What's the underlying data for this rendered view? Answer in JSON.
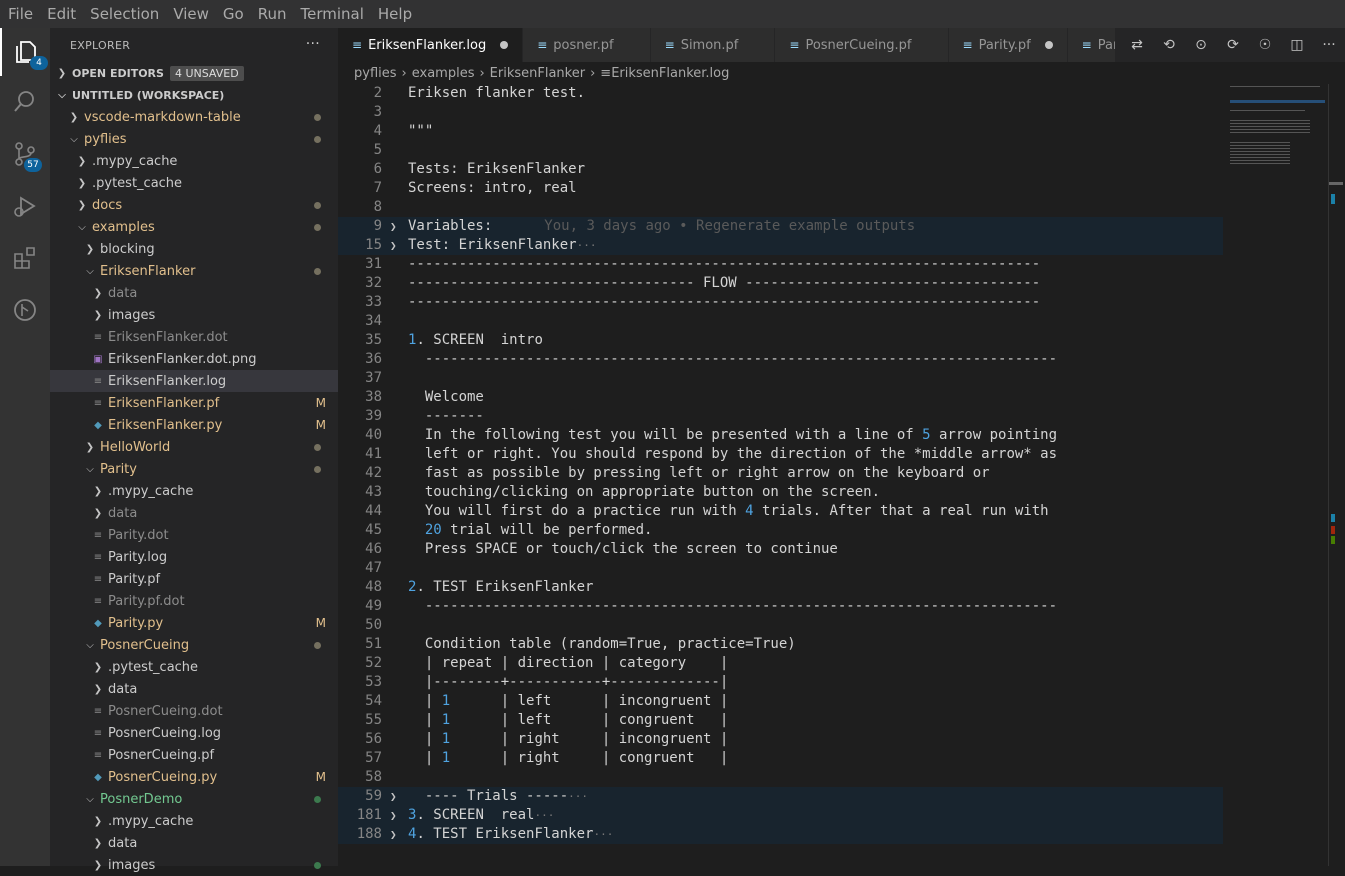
{
  "menu": [
    "File",
    "Edit",
    "Selection",
    "View",
    "Go",
    "Run",
    "Terminal",
    "Help"
  ],
  "activity": {
    "explorer_badge": "4",
    "scm_badge": "57"
  },
  "sidebar": {
    "title": "EXPLORER",
    "open_editors": "OPEN EDITORS",
    "unsaved": "4 UNSAVED",
    "workspace": "UNTITLED (WORKSPACE)",
    "tree": [
      {
        "label": "vscode-markdown-table",
        "indent": 0,
        "type": "folder",
        "open": false,
        "color": "#e2c08d",
        "deco": "dot"
      },
      {
        "label": "pyflies",
        "indent": 0,
        "type": "folder",
        "open": true,
        "color": "#e2c08d",
        "deco": "dot"
      },
      {
        "label": ".mypy_cache",
        "indent": 1,
        "type": "folder",
        "open": false,
        "color": "#cccccc",
        "deco": ""
      },
      {
        "label": ".pytest_cache",
        "indent": 1,
        "type": "folder",
        "open": false,
        "color": "#cccccc",
        "deco": ""
      },
      {
        "label": "docs",
        "indent": 1,
        "type": "folder",
        "open": false,
        "color": "#e2c08d",
        "deco": "dot"
      },
      {
        "label": "examples",
        "indent": 1,
        "type": "folder",
        "open": true,
        "color": "#e2c08d",
        "deco": "dot"
      },
      {
        "label": "blocking",
        "indent": 2,
        "type": "folder",
        "open": false,
        "color": "#cccccc",
        "deco": ""
      },
      {
        "label": "EriksenFlanker",
        "indent": 2,
        "type": "folder",
        "open": true,
        "color": "#e2c08d",
        "deco": "dot"
      },
      {
        "label": "data",
        "indent": 3,
        "type": "folder",
        "open": false,
        "color": "#8c8c8c",
        "deco": ""
      },
      {
        "label": "images",
        "indent": 3,
        "type": "folder",
        "open": false,
        "color": "#cccccc",
        "deco": ""
      },
      {
        "label": "EriksenFlanker.dot",
        "indent": 3,
        "type": "file",
        "icon": "≡",
        "color": "#8c8c8c",
        "deco": ""
      },
      {
        "label": "EriksenFlanker.dot.png",
        "indent": 3,
        "type": "file",
        "icon": "▣",
        "color": "#cccccc",
        "deco": ""
      },
      {
        "label": "EriksenFlanker.log",
        "indent": 3,
        "type": "file",
        "icon": "≡",
        "color": "#cccccc",
        "deco": "",
        "selected": true
      },
      {
        "label": "EriksenFlanker.pf",
        "indent": 3,
        "type": "file",
        "icon": "≡",
        "color": "#e2c08d",
        "deco": "M"
      },
      {
        "label": "EriksenFlanker.py",
        "indent": 3,
        "type": "file",
        "icon": "◆",
        "color": "#e2c08d",
        "deco": "M"
      },
      {
        "label": "HelloWorld",
        "indent": 2,
        "type": "folder",
        "open": false,
        "color": "#e2c08d",
        "deco": "dot"
      },
      {
        "label": "Parity",
        "indent": 2,
        "type": "folder",
        "open": true,
        "color": "#e2c08d",
        "deco": "dot"
      },
      {
        "label": ".mypy_cache",
        "indent": 3,
        "type": "folder",
        "open": false,
        "color": "#cccccc",
        "deco": ""
      },
      {
        "label": "data",
        "indent": 3,
        "type": "folder",
        "open": false,
        "color": "#8c8c8c",
        "deco": ""
      },
      {
        "label": "Parity.dot",
        "indent": 3,
        "type": "file",
        "icon": "≡",
        "color": "#8c8c8c",
        "deco": ""
      },
      {
        "label": "Parity.log",
        "indent": 3,
        "type": "file",
        "icon": "≡",
        "color": "#cccccc",
        "deco": ""
      },
      {
        "label": "Parity.pf",
        "indent": 3,
        "type": "file",
        "icon": "≡",
        "color": "#cccccc",
        "deco": ""
      },
      {
        "label": "Parity.pf.dot",
        "indent": 3,
        "type": "file",
        "icon": "≡",
        "color": "#8c8c8c",
        "deco": ""
      },
      {
        "label": "Parity.py",
        "indent": 3,
        "type": "file",
        "icon": "◆",
        "color": "#e2c08d",
        "deco": "M"
      },
      {
        "label": "PosnerCueing",
        "indent": 2,
        "type": "folder",
        "open": true,
        "color": "#e2c08d",
        "deco": "dot"
      },
      {
        "label": ".pytest_cache",
        "indent": 3,
        "type": "folder",
        "open": false,
        "color": "#cccccc",
        "deco": ""
      },
      {
        "label": "data",
        "indent": 3,
        "type": "folder",
        "open": false,
        "color": "#cccccc",
        "deco": ""
      },
      {
        "label": "PosnerCueing.dot",
        "indent": 3,
        "type": "file",
        "icon": "≡",
        "color": "#8c8c8c",
        "deco": ""
      },
      {
        "label": "PosnerCueing.log",
        "indent": 3,
        "type": "file",
        "icon": "≡",
        "color": "#cccccc",
        "deco": ""
      },
      {
        "label": "PosnerCueing.pf",
        "indent": 3,
        "type": "file",
        "icon": "≡",
        "color": "#cccccc",
        "deco": ""
      },
      {
        "label": "PosnerCueing.py",
        "indent": 3,
        "type": "file",
        "icon": "◆",
        "color": "#e2c08d",
        "deco": "M"
      },
      {
        "label": "PosnerDemo",
        "indent": 2,
        "type": "folder",
        "open": true,
        "color": "#73c991",
        "deco": "gdot"
      },
      {
        "label": ".mypy_cache",
        "indent": 3,
        "type": "folder",
        "open": false,
        "color": "#cccccc",
        "deco": ""
      },
      {
        "label": "data",
        "indent": 3,
        "type": "folder",
        "open": false,
        "color": "#cccccc",
        "deco": ""
      },
      {
        "label": "images",
        "indent": 3,
        "type": "folder",
        "open": false,
        "color": "#cccccc",
        "deco": "gdot"
      }
    ]
  },
  "tabs": [
    {
      "label": "EriksenFlanker.log",
      "active": true,
      "dirty": true
    },
    {
      "label": "posner.pf",
      "active": false,
      "dirty": false
    },
    {
      "label": "Simon.pf",
      "active": false,
      "dirty": false
    },
    {
      "label": "PosnerCueing.pf",
      "active": false,
      "dirty": false
    },
    {
      "label": "Parity.pf",
      "active": false,
      "dirty": true
    },
    {
      "label": "Parity.l",
      "active": false,
      "dirty": false
    }
  ],
  "breadcrumb": [
    "pyflies",
    "examples",
    "EriksenFlanker",
    "EriksenFlanker.log"
  ],
  "code": [
    {
      "n": "2",
      "t": "Eriksen flanker test."
    },
    {
      "n": "3",
      "t": ""
    },
    {
      "n": "4",
      "t": "\"\"\""
    },
    {
      "n": "5",
      "t": ""
    },
    {
      "n": "6",
      "t": "Tests: EriksenFlanker"
    },
    {
      "n": "7",
      "t": "Screens: intro, real"
    },
    {
      "n": "8",
      "t": ""
    },
    {
      "n": "9",
      "t": "Variables:",
      "fold": true,
      "blame": "You, 3 days ago • Regenerate example outputs"
    },
    {
      "n": "15",
      "t": "Test: EriksenFlanker",
      "fold": true,
      "ell": true
    },
    {
      "n": "31",
      "t": "---------------------------------------------------------------------------"
    },
    {
      "n": "32",
      "t": "---------------------------------- FLOW -----------------------------------"
    },
    {
      "n": "33",
      "t": "---------------------------------------------------------------------------"
    },
    {
      "n": "34",
      "t": ""
    },
    {
      "n": "35",
      "t": "1. SCREEN  intro",
      "lead": "1"
    },
    {
      "n": "36",
      "t": "  ---------------------------------------------------------------------------"
    },
    {
      "n": "37",
      "t": ""
    },
    {
      "n": "38",
      "t": "  Welcome"
    },
    {
      "n": "39",
      "t": "  -------"
    },
    {
      "n": "40",
      "t": "  In the following test you will be presented with a line of 5 arrow pointing",
      "hl": "5"
    },
    {
      "n": "41",
      "t": "  left or right. You should respond by the direction of the *middle arrow* as"
    },
    {
      "n": "42",
      "t": "  fast as possible by pressing left or right arrow on the keyboard or"
    },
    {
      "n": "43",
      "t": "  touching/clicking on appropriate button on the screen."
    },
    {
      "n": "44",
      "t": "  You will first do a practice run with 4 trials. After that a real run with",
      "hl": "4"
    },
    {
      "n": "45",
      "t": "  20 trial will be performed.",
      "hl": "20"
    },
    {
      "n": "46",
      "t": "  Press SPACE or touch/click the screen to continue"
    },
    {
      "n": "47",
      "t": ""
    },
    {
      "n": "48",
      "t": "2. TEST EriksenFlanker",
      "lead": "2"
    },
    {
      "n": "49",
      "t": "  ---------------------------------------------------------------------------"
    },
    {
      "n": "50",
      "t": ""
    },
    {
      "n": "51",
      "t": "  Condition table (random=True, practice=True)"
    },
    {
      "n": "52",
      "t": "  | repeat | direction | category    |"
    },
    {
      "n": "53",
      "t": "  |--------+-----------+-------------|"
    },
    {
      "n": "54",
      "t": "  | 1      | left      | incongruent |",
      "hl": "1"
    },
    {
      "n": "55",
      "t": "  | 1      | left      | congruent   |",
      "hl": "1"
    },
    {
      "n": "56",
      "t": "  | 1      | right     | incongruent |",
      "hl": "1"
    },
    {
      "n": "57",
      "t": "  | 1      | right     | congruent   |",
      "hl": "1"
    },
    {
      "n": "58",
      "t": ""
    },
    {
      "n": "59",
      "t": "  ---- Trials -----",
      "fold": true,
      "ell": true
    },
    {
      "n": "181",
      "t": "3. SCREEN  real",
      "fold": true,
      "ell": true,
      "lead": "3"
    },
    {
      "n": "188",
      "t": "4. TEST EriksenFlanker",
      "fold": true,
      "ell": true,
      "lead": "4"
    }
  ]
}
